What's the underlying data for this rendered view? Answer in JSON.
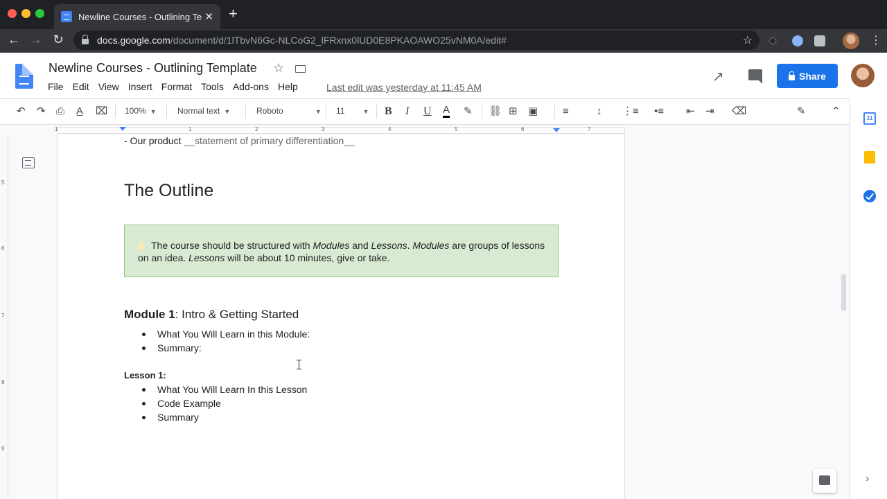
{
  "browser": {
    "tab_title": "Newline Courses - Outlining Te",
    "tab_close": "✕",
    "new_tab": "+",
    "url_domain": "docs.google.com",
    "url_path": "/document/d/1lTbvN6Gc-NLCoG2_lFRxnx0lUD0E8PKAOAWO25vNM0A/edit#",
    "back": "←",
    "forward": "→",
    "reload": "↻",
    "bookmark_star": "☆",
    "menu": "⋮"
  },
  "docs": {
    "title": "Newline Courses - Outlining Template",
    "title_star": "☆",
    "menu": [
      "File",
      "Edit",
      "View",
      "Insert",
      "Format",
      "Tools",
      "Add-ons",
      "Help"
    ],
    "last_edit": "Last edit was yesterday at 11:45 AM",
    "activity_icon": "↗",
    "share_label": "Share"
  },
  "toolbar": {
    "undo": "↶",
    "redo": "↷",
    "print": "⎙",
    "spellcheck": "A̲",
    "paint_format": "⌧",
    "zoom": "100%",
    "style": "Normal text",
    "font": "Roboto",
    "size": "11",
    "bold": "B",
    "italic": "I",
    "underline": "U",
    "text_color": "A",
    "highlight": "✎",
    "link": "⛓",
    "comment": "⊞",
    "image": "▣",
    "align": "≡",
    "line_spacing": "↕",
    "numbered_list": "⋮≡",
    "bulleted_list": "•≡",
    "decrease_indent": "⇤",
    "increase_indent": "⇥",
    "clear_format": "⌫",
    "editing": "✎",
    "collapse": "⌃"
  },
  "ruler": {
    "numbers": [
      "1",
      "1",
      "2",
      "3",
      "4",
      "5",
      "6",
      "7"
    ],
    "vertical": [
      "5",
      "6",
      "7",
      "8",
      "9"
    ]
  },
  "document": {
    "top_line_prefix": "- Our product ",
    "top_line_muted": "__statement of primary differentiation__",
    "heading": "The Outline",
    "callout": {
      "t1": "The course should be structured with ",
      "i1": "Modules",
      "t2": " and ",
      "i2": "Lessons",
      "t3": ". ",
      "i3": "Modules",
      "t4": " are groups of lessons on an idea. ",
      "i4": "Lessons",
      "t5": " will be about 10 minutes, give or take."
    },
    "module_bold": "Module 1",
    "module_rest": ": Intro & Getting Started",
    "module_items": [
      "What You Will Learn in this Module:",
      "Summary:"
    ],
    "lesson_heading": "Lesson 1:",
    "lesson_items": [
      "What You Will Learn In this Lesson",
      "Code Example",
      "Summary"
    ]
  },
  "side_panel": {
    "calendar_label": "31",
    "expand": "›"
  }
}
